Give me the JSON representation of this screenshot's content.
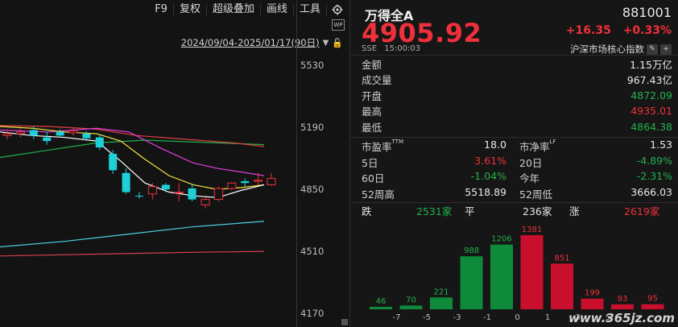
{
  "toolbar": {
    "items": [
      "F9",
      "复权",
      "超级叠加",
      "画线",
      "工具"
    ],
    "gear_icon": "gear-icon"
  },
  "chart_header": {
    "range": "2024/09/04-2025/01/17(90日)",
    "wp_badge": "WP"
  },
  "chart_data": {
    "type": "candlestick",
    "y_ticks": [
      "5530",
      "5190",
      "4850",
      "4510",
      "4170"
    ],
    "ylim": [
      4170,
      5530
    ],
    "colors": {
      "up": "#f0303a",
      "down": "#1fd0d8",
      "ma5": "#ffffff",
      "ma10": "#f5e342",
      "ma20": "#e040e0",
      "ma30": "#22b14c",
      "ma60": "#e04040",
      "ma120": "#4ad0e0",
      "ma250": "#d04050"
    },
    "candles": [
      {
        "o": 5150,
        "h": 5175,
        "l": 5120,
        "c": 5140,
        "dir": "up"
      },
      {
        "o": 5160,
        "h": 5180,
        "l": 5130,
        "c": 5150,
        "dir": "up"
      },
      {
        "o": 5170,
        "h": 5190,
        "l": 5120,
        "c": 5140,
        "dir": "down"
      },
      {
        "o": 5130,
        "h": 5160,
        "l": 5090,
        "c": 5110,
        "dir": "down"
      },
      {
        "o": 5160,
        "h": 5175,
        "l": 5130,
        "c": 5140,
        "dir": "down"
      },
      {
        "o": 5165,
        "h": 5185,
        "l": 5140,
        "c": 5155,
        "dir": "up"
      },
      {
        "o": 5150,
        "h": 5165,
        "l": 5110,
        "c": 5125,
        "dir": "down"
      },
      {
        "o": 5130,
        "h": 5150,
        "l": 5060,
        "c": 5075,
        "dir": "down"
      },
      {
        "o": 5040,
        "h": 5060,
        "l": 4930,
        "c": 4950,
        "dir": "down"
      },
      {
        "o": 4935,
        "h": 4960,
        "l": 4820,
        "c": 4830,
        "dir": "down"
      },
      {
        "o": 4810,
        "h": 4830,
        "l": 4795,
        "c": 4810,
        "dir": "down"
      },
      {
        "o": 4820,
        "h": 4880,
        "l": 4790,
        "c": 4860,
        "dir": "up"
      },
      {
        "o": 4870,
        "h": 4880,
        "l": 4830,
        "c": 4845,
        "dir": "down"
      },
      {
        "o": 4830,
        "h": 4880,
        "l": 4780,
        "c": 4830,
        "dir": "up"
      },
      {
        "o": 4850,
        "h": 4875,
        "l": 4780,
        "c": 4790,
        "dir": "down"
      },
      {
        "o": 4760,
        "h": 4800,
        "l": 4740,
        "c": 4790,
        "dir": "up"
      },
      {
        "o": 4790,
        "h": 4860,
        "l": 4780,
        "c": 4850,
        "dir": "up"
      },
      {
        "o": 4850,
        "h": 4885,
        "l": 4840,
        "c": 4880,
        "dir": "up"
      },
      {
        "o": 4880,
        "h": 4905,
        "l": 4860,
        "c": 4890,
        "dir": "down"
      },
      {
        "o": 4890,
        "h": 4935,
        "l": 4870,
        "c": 4895,
        "dir": "up"
      },
      {
        "o": 4870,
        "h": 4935,
        "l": 4865,
        "c": 4905,
        "dir": "up"
      }
    ]
  },
  "quote": {
    "name": "万得全A",
    "code": "881001",
    "price": "4905.92",
    "change": "+16.35",
    "change_pct": "+0.33%",
    "exchange": "SSE",
    "time": "15:00:03",
    "index_label": "沪深市场核心指数",
    "rows": [
      {
        "k": "金额",
        "v": "1.15万亿",
        "color": "white"
      },
      {
        "k": "成交量",
        "v": "967.43亿",
        "color": "white"
      },
      {
        "k": "开盘",
        "v": "4872.09",
        "color": "green"
      },
      {
        "k": "最高",
        "v": "4935.01",
        "color": "red"
      },
      {
        "k": "最低",
        "v": "4864.38",
        "color": "green"
      }
    ],
    "stats": [
      {
        "k1": "市盈率",
        "sup1": "TTM",
        "v1": "18.0",
        "c1": "white",
        "k2": "市净率",
        "sup2": "LF",
        "v2": "1.53",
        "c2": "white"
      },
      {
        "k1": "5日",
        "sup1": "",
        "v1": "3.61%",
        "c1": "red",
        "k2": "20日",
        "sup2": "",
        "v2": "-4.89%",
        "c2": "green"
      },
      {
        "k1": "60日",
        "sup1": "",
        "v1": "-1.04%",
        "c1": "green",
        "k2": "今年",
        "sup2": "",
        "v2": "-2.31%",
        "c2": "green"
      },
      {
        "k1": "52周高",
        "sup1": "",
        "v1": "5518.89",
        "c1": "white",
        "k2": "52周低",
        "sup2": "",
        "v2": "3666.03",
        "c2": "white"
      }
    ],
    "breadth": {
      "down_label": "跌",
      "down_value": "2531家",
      "flat_label": "平",
      "flat_value": "236家",
      "up_label": "涨",
      "up_value": "2619家"
    }
  },
  "distribution": {
    "bins": [
      {
        "label": "",
        "value": 46,
        "color": "green"
      },
      {
        "label": "-7",
        "value": 70,
        "color": "green"
      },
      {
        "label": "-5",
        "value": 221,
        "color": "green"
      },
      {
        "label": "-3",
        "value": 988,
        "color": "green"
      },
      {
        "label": "-1",
        "value": 1206,
        "color": "green"
      },
      {
        "label": "0",
        "value": 1381,
        "color": "red"
      },
      {
        "label": "1",
        "value": 851,
        "color": "red"
      },
      {
        "label": "3",
        "value": 199,
        "color": "red"
      },
      {
        "label": "5",
        "value": 93,
        "color": "red"
      },
      {
        "label": "7",
        "value": 95,
        "color": "red"
      }
    ],
    "tick_labels": [
      "-7",
      "-5",
      "-3",
      "-1",
      "0",
      "1",
      "3",
      "5"
    ]
  },
  "watermark": "www.365jz.com"
}
